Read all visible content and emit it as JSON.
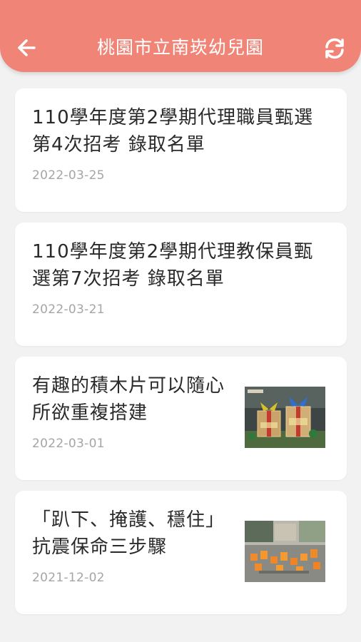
{
  "header": {
    "title": "桃園市立南崁幼兒園",
    "back_icon": "arrow-left-icon",
    "refresh_icon": "refresh-icon",
    "background_color": "#f08577"
  },
  "news": [
    {
      "title": "110學年度第2學期代理職員甄選第4次招考 錄取名單",
      "date": "2022-03-25"
    },
    {
      "title": "110學年度第2學期代理教保員甄選第7次招考 錄取名單",
      "date": "2022-03-21"
    },
    {
      "title": "有趣的積木片可以隨心所欲重複搭建",
      "date": "2022-03-01",
      "thumbnail": "gift-box-blocks-photo"
    },
    {
      "title": "「趴下、掩護、穩住」抗震保命三步驟",
      "date": "2021-12-02",
      "thumbnail": "earthquake-drill-photo"
    }
  ]
}
